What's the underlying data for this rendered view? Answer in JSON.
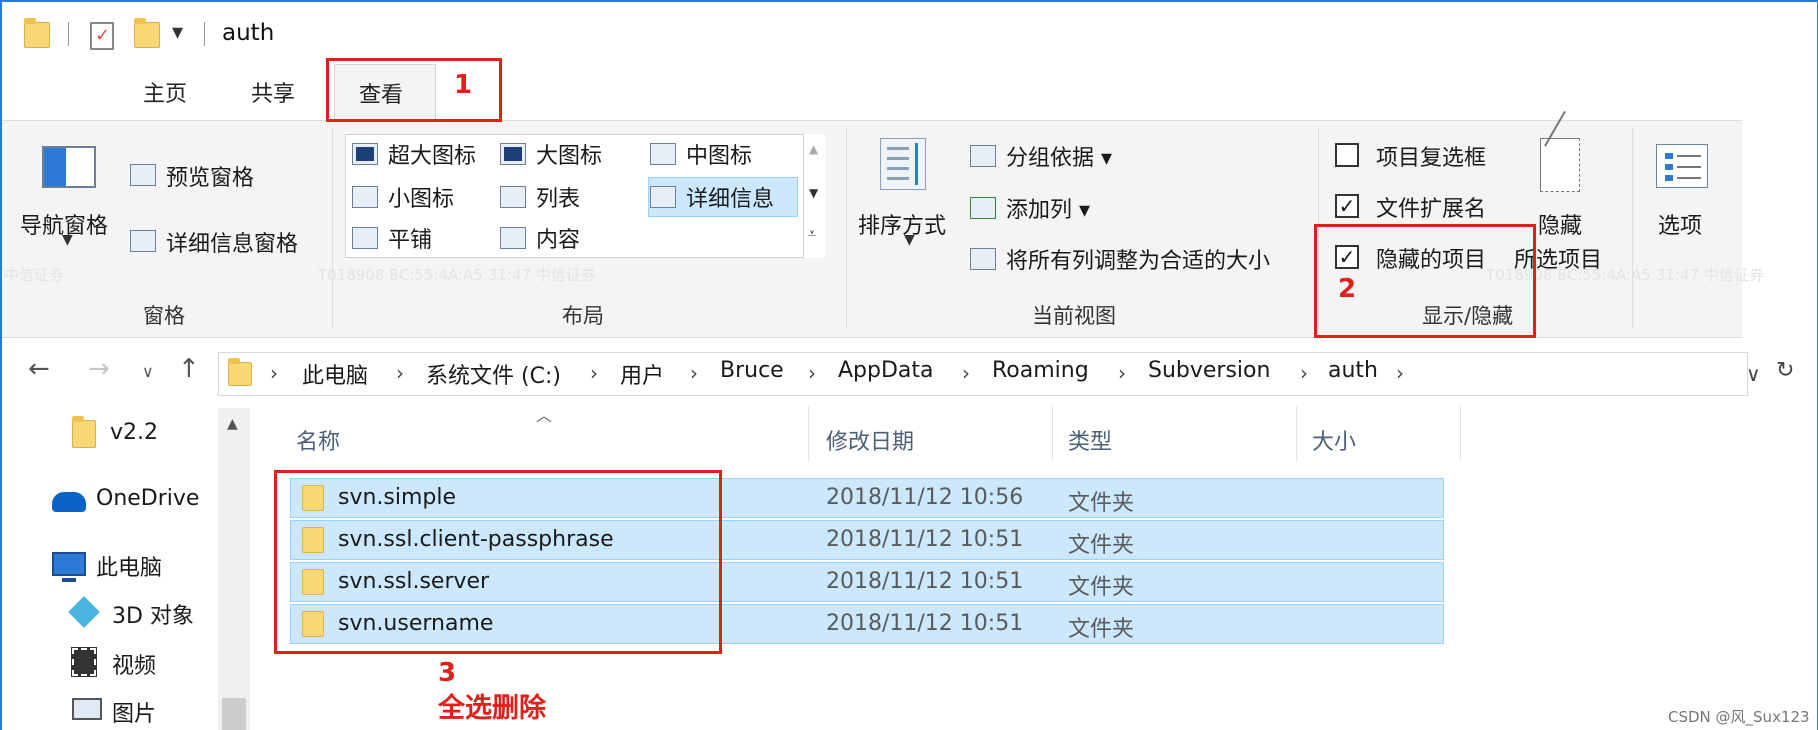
{
  "window": {
    "title": "auth",
    "qa_dropdown": "▾"
  },
  "tabs": [
    {
      "label": "主页"
    },
    {
      "label": "共享"
    },
    {
      "label": "查看"
    }
  ],
  "ribbon": {
    "panes": {
      "label": "窗格",
      "nav_pane": "导航窗格",
      "preview_pane": "预览窗格",
      "details_pane": "详细信息窗格"
    },
    "layout": {
      "label": "布局",
      "items": [
        "超大图标",
        "大图标",
        "中图标",
        "小图标",
        "列表",
        "详细信息",
        "平铺",
        "内容"
      ]
    },
    "current_view": {
      "label": "当前视图",
      "sort_by": "排序方式",
      "group_by": "分组依据 ▾",
      "add_column": "添加列 ▾",
      "fit_columns": "将所有列调整为合适的大小"
    },
    "show_hide": {
      "label": "显示/隐藏",
      "item_checkboxes": "项目复选框",
      "file_extensions": "文件扩展名",
      "hidden_items": "隐藏的项目",
      "hide_selected_1": "隐藏",
      "hide_selected_2": "所选项目"
    },
    "options": {
      "label": "选项"
    }
  },
  "address_bar": {
    "crumbs": [
      "此电脑",
      "系统文件 (C:)",
      "用户",
      "Bruce",
      "AppData",
      "Roaming",
      "Subversion",
      "auth"
    ],
    "dropdown": "∨"
  },
  "nav_pane": {
    "items": [
      {
        "label": "v2.2"
      },
      {
        "label": "OneDrive"
      },
      {
        "label": "此电脑"
      },
      {
        "label": "3D 对象"
      },
      {
        "label": "视频"
      },
      {
        "label": "图片"
      }
    ]
  },
  "file_list": {
    "columns": [
      "名称",
      "修改日期",
      "类型",
      "大小"
    ],
    "rows": [
      {
        "name": "svn.simple",
        "date": "2018/11/12 10:56",
        "type": "文件夹"
      },
      {
        "name": "svn.ssl.client-passphrase",
        "date": "2018/11/12 10:51",
        "type": "文件夹"
      },
      {
        "name": "svn.ssl.server",
        "date": "2018/11/12 10:51",
        "type": "文件夹"
      },
      {
        "name": "svn.username",
        "date": "2018/11/12 10:51",
        "type": "文件夹"
      }
    ]
  },
  "annotations": {
    "step1": "1",
    "step2": "2",
    "step3": "3",
    "step3_text": "全选删除"
  },
  "watermarks": {
    "left": "中信证券",
    "center": "T018908   8C:55:4A:A5:31:47   中信证券",
    "right": "T018908   8C:55:4A:A5:31:47   中信证券"
  },
  "footer": {
    "csdn": "CSDN @风_Sux123"
  },
  "colors": {
    "selection_fill": "#cce8ff",
    "selection_border": "#99d1ff",
    "annotation_red": "#e0201b",
    "window_border": "#2b79d8",
    "folder_yellow": "#f8d775"
  }
}
